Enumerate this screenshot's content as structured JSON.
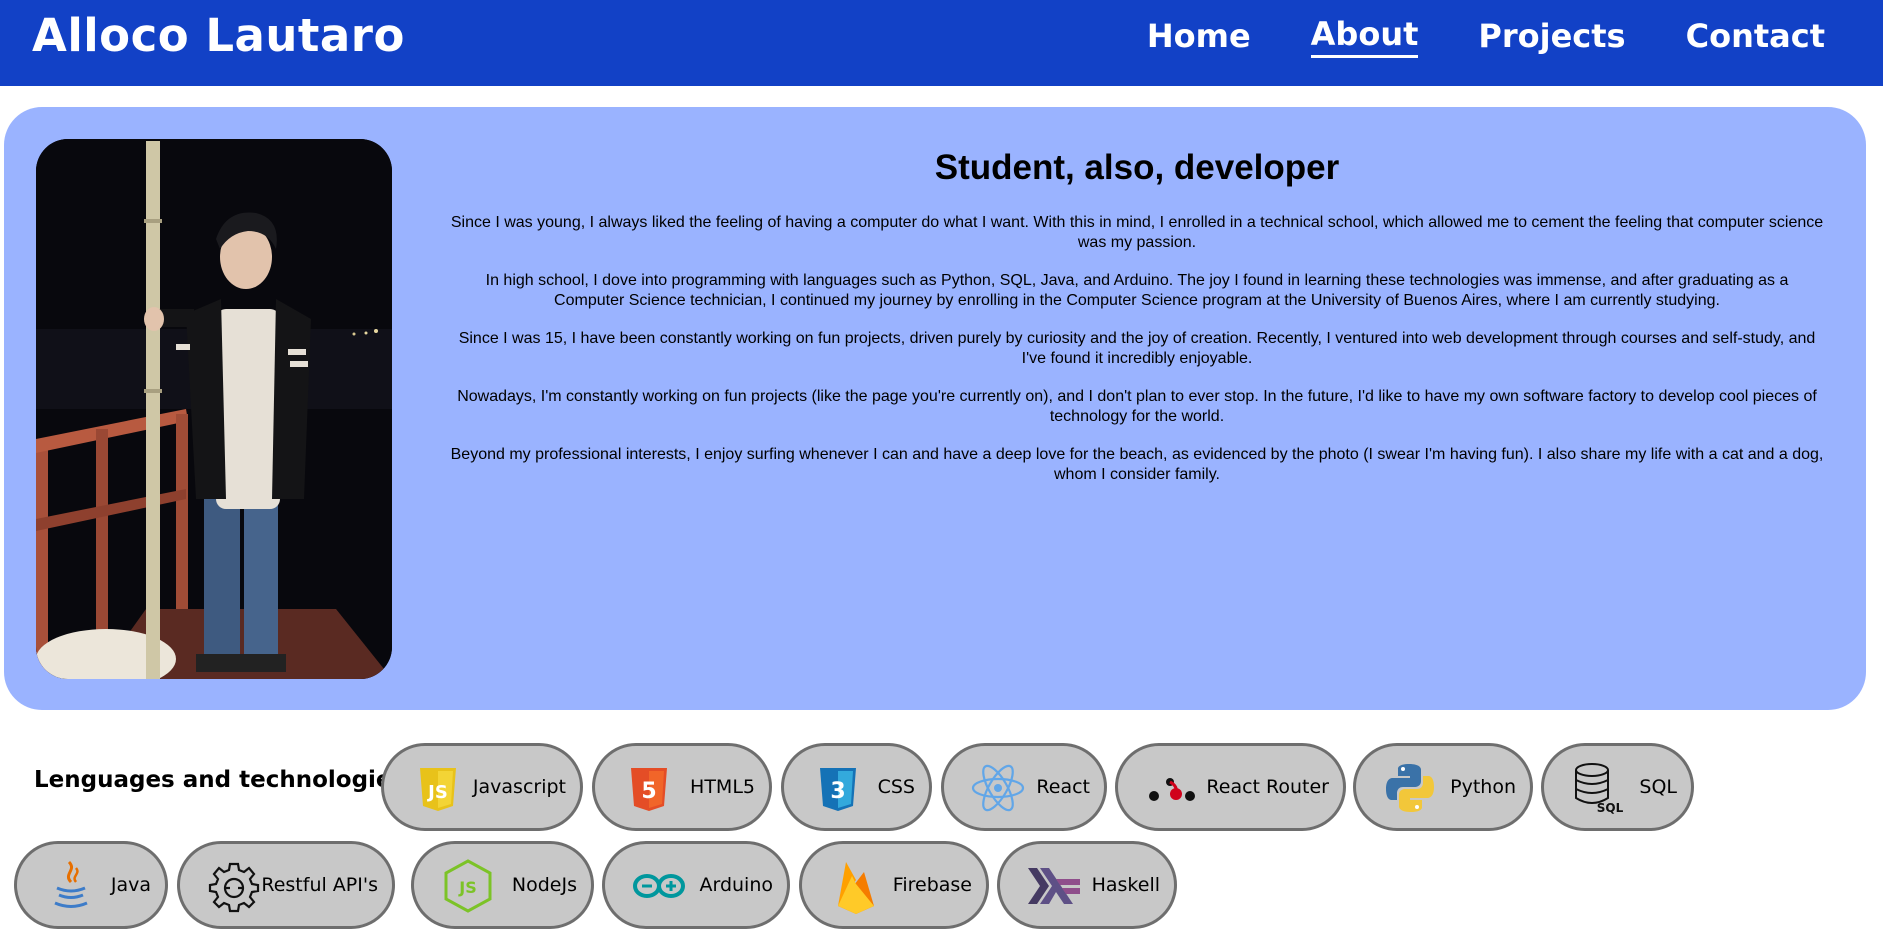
{
  "header": {
    "brand": "Alloco Lautaro",
    "nav": [
      {
        "label": "Home"
      },
      {
        "label": "About"
      },
      {
        "label": "Projects"
      },
      {
        "label": "Contact"
      }
    ]
  },
  "about": {
    "title": "Student, also, developer",
    "paragraphs": [
      "Since I was young, I always liked the feeling of having a computer do what I want. With this in mind, I enrolled in a technical school, which allowed me to cement the feeling that computer science was my passion.",
      "In high school, I dove into programming with languages such as Python, SQL, Java, and Arduino. The joy I found in learning these technologies was immense, and after graduating as a Computer Science technician, I continued my journey by enrolling in the Computer Science program at the University of Buenos Aires, where I am currently studying.",
      "Since I was 15, I have been constantly working on fun projects, driven purely by curiosity and the joy of creation. Recently, I ventured into web development through courses and self-study, and I've found it incredibly enjoyable.",
      "Nowadays, I'm constantly working on fun projects (like the page you're currently on), and I don't plan to ever stop. In the future, I'd like to have my own software factory to develop cool pieces of technology for the world.",
      "Beyond my professional interests, I enjoy surfing whenever I can and have a deep love for the beach, as evidenced by the photo (I swear I'm having fun). I also share my life with a cat and a dog, whom I consider family."
    ]
  },
  "skills": {
    "label": "Lenguages and technologies:",
    "items": [
      {
        "label": "Javascript",
        "icon": "javascript-icon"
      },
      {
        "label": "HTML5",
        "icon": "html5-icon"
      },
      {
        "label": "CSS",
        "icon": "css3-icon"
      },
      {
        "label": "React",
        "icon": "react-icon"
      },
      {
        "label": "React Router",
        "icon": "react-router-icon"
      },
      {
        "label": "Python",
        "icon": "python-icon"
      },
      {
        "label": "SQL",
        "icon": "sql-icon"
      },
      {
        "label": "Java",
        "icon": "java-icon"
      },
      {
        "label": "Restful API's",
        "icon": "gear-api-icon"
      },
      {
        "label": "NodeJs",
        "icon": "nodejs-icon"
      },
      {
        "label": "Arduino",
        "icon": "arduino-icon"
      },
      {
        "label": "Firebase",
        "icon": "firebase-icon"
      },
      {
        "label": "Haskell",
        "icon": "haskell-icon"
      }
    ]
  },
  "colors": {
    "header_bg": "#1241c6",
    "card_bg": "#9ab3ff",
    "pill_bg": "#c8c8c8",
    "pill_border": "#6e6e6e"
  }
}
